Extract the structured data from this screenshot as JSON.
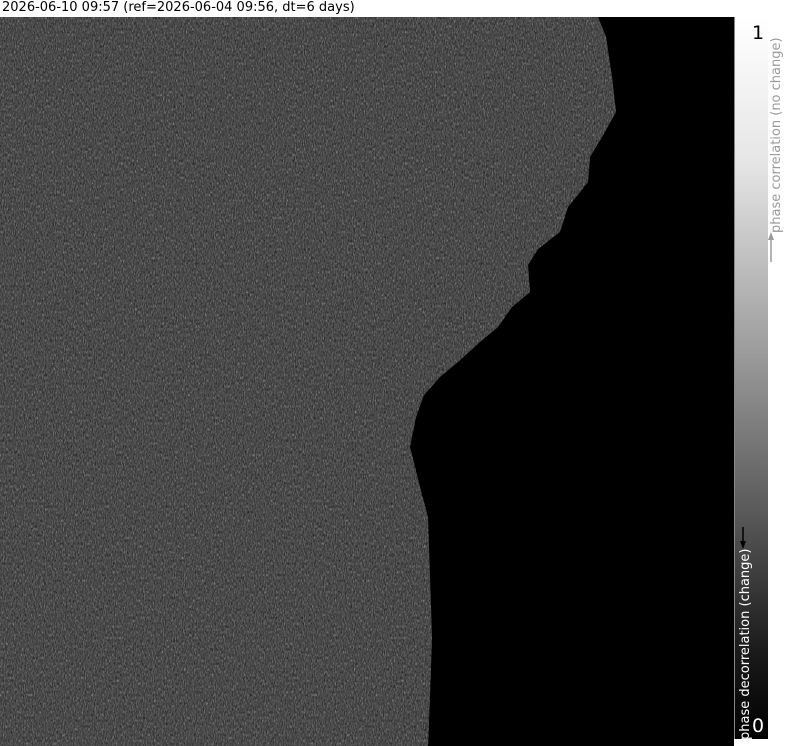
{
  "header": {
    "title": "2026-06-10 09:57 (ref=2026-06-04 09:56, dt=6 days)"
  },
  "colorbar": {
    "max_label": "1",
    "min_label": "0",
    "top_label": "phase correlation (no change)",
    "bottom_label": "phase decorrelation (change)",
    "colors": {
      "high": "#ffffff",
      "low": "#000000"
    }
  },
  "scene": {
    "description_colors": {
      "land": "#4a4a4a",
      "ocean": "#000000"
    }
  }
}
